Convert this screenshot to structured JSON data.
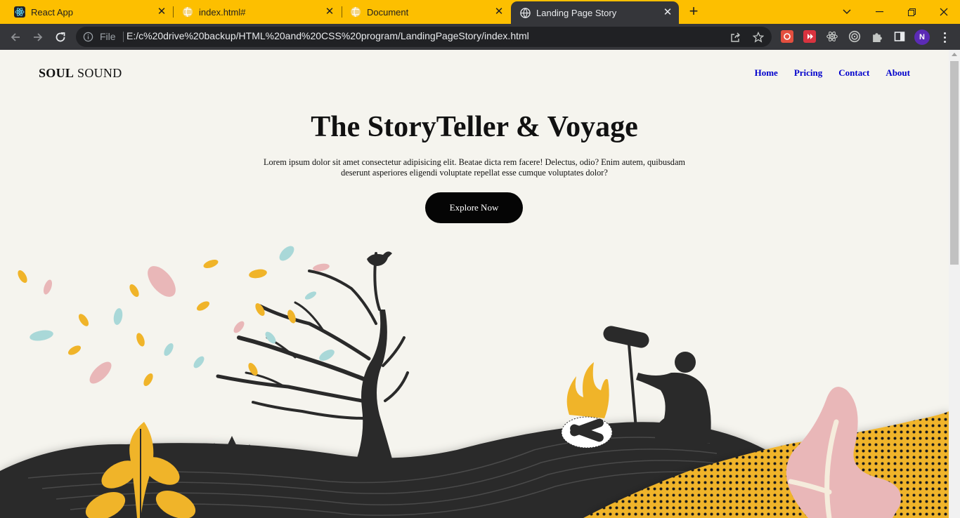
{
  "browser": {
    "tabs": [
      {
        "title": "React App",
        "icon": "react-icon",
        "active": false
      },
      {
        "title": "index.html#",
        "icon": "globe-icon",
        "active": false
      },
      {
        "title": "Document",
        "icon": "globe-icon",
        "active": false
      },
      {
        "title": "Landing Page Story",
        "icon": "globe-icon",
        "active": true
      }
    ],
    "address": {
      "scheme_label": "File",
      "url": "E:/c%20drive%20backup/HTML%20and%20CSS%20program/LandingPageStory/index.html"
    },
    "profile_initial": "N",
    "colors": {
      "tabbar": "#fdbf00",
      "toolbar": "#35363a",
      "omnibox": "#202124"
    }
  },
  "page": {
    "logo_bold": "SOUL",
    "logo_rest": " SOUND",
    "nav": [
      "Home",
      "Pricing",
      "Contact",
      "About"
    ],
    "hero": {
      "title": "The StoryTeller & Voyage",
      "text": "Lorem ipsum dolor sit amet consectetur adipisicing elit. Beatae dicta rem facere! Delectus, odio? Enim autem, quibusdam deserunt asperiores eligendi voluptate repellat esse cumque voluptates dolor?",
      "button": "Explore Now"
    },
    "colors": {
      "background": "#f5f4ee",
      "nav_link": "#0000cc",
      "hill": "#2a2a2a",
      "yellow": "#f0b429",
      "pink": "#e9b7b8",
      "teal": "#a9d8d8"
    }
  }
}
